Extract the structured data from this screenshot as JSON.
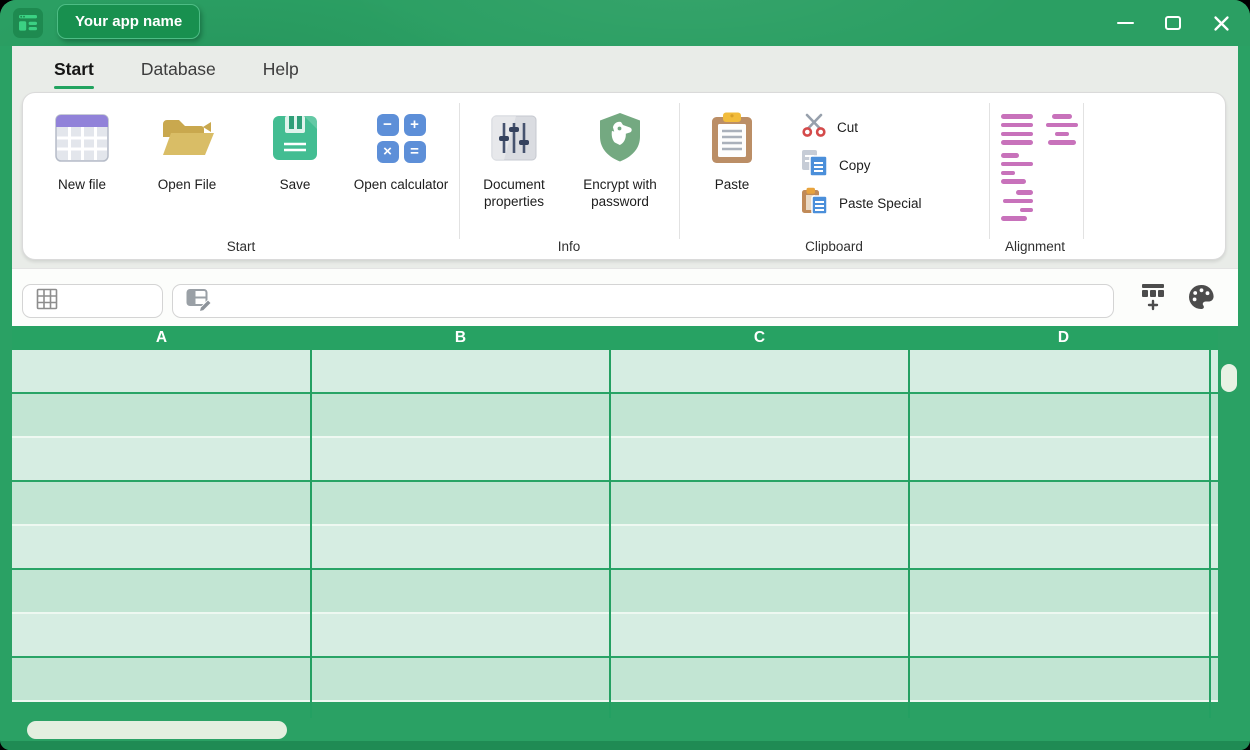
{
  "window": {
    "app_badge": "Your app name"
  },
  "menu": {
    "tabs": [
      {
        "label": "Start",
        "active": true
      },
      {
        "label": "Database",
        "active": false
      },
      {
        "label": "Help",
        "active": false
      }
    ]
  },
  "ribbon": {
    "groups": [
      {
        "label": "Start",
        "items": [
          {
            "label": "New file",
            "icon": "new-file-table-icon"
          },
          {
            "label": "Open File",
            "icon": "open-folder-icon"
          },
          {
            "label": "Save",
            "icon": "floppy-disk-icon"
          },
          {
            "label": "Open calculator",
            "icon": "calculator-icon"
          }
        ]
      },
      {
        "label": "Info",
        "items": [
          {
            "label": "Document properties",
            "icon": "sliders-icon"
          },
          {
            "label": "Encrypt with password",
            "icon": "shield-dog-icon"
          }
        ]
      },
      {
        "label": "Clipboard",
        "items": [
          {
            "label": "Paste",
            "icon": "clipboard-icon"
          },
          {
            "label": "Cut",
            "icon": "scissors-icon"
          },
          {
            "label": "Copy",
            "icon": "copy-icon"
          },
          {
            "label": "Paste Special",
            "icon": "paste-special-icon"
          }
        ]
      },
      {
        "label": "Alignment",
        "items": [
          {
            "icon": "align-justify-icon"
          },
          {
            "icon": "align-center-icon"
          },
          {
            "icon": "align-left-icon"
          },
          {
            "icon": "align-right-icon"
          }
        ]
      }
    ]
  },
  "icons": {
    "calculator_symbols": [
      "−",
      "+",
      "×",
      "="
    ]
  },
  "formula_bar": {
    "cell_reference_value": "",
    "formula_value": ""
  },
  "spreadsheet": {
    "columns": [
      "A",
      "B",
      "C",
      "D"
    ],
    "visible_rows": 8
  },
  "colors": {
    "frame_green": "#2aa164",
    "titlebar_green": "#2b9f63",
    "badge_green": "#18904f",
    "header_green": "#27a263",
    "row_light": "#d6ede2",
    "row_dark": "#c2e5d3",
    "alignment_pink": "#c872bb",
    "calculator_blue": "#5d8fd8",
    "accent_underline": "#21a35f"
  }
}
